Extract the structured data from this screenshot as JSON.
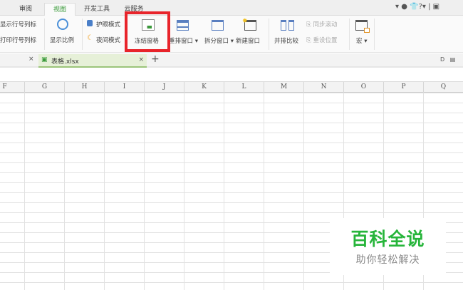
{
  "menu_tabs": [
    "审阅",
    "视图",
    "开发工具",
    "云服务"
  ],
  "active_tab": "视图",
  "ribbon": {
    "show_row_col": "显示行号列标",
    "print_row_col": "打印行号列标",
    "zoom": "显示比例",
    "eye_mode": "护眼模式",
    "night_mode": "夜间模式",
    "freeze": "冻结窗格",
    "arrange": "重排窗口",
    "split": "拆分窗口",
    "new_window": "新建窗口",
    "side_by_side": "并排比较",
    "sync_scroll": "同步滚动",
    "reset_pos": "重设位置",
    "macro": "宏"
  },
  "top_right": [
    "?"
  ],
  "document_tab": {
    "name": "表格.xlsx",
    "close": "×",
    "add": "+",
    "left_close": "×"
  },
  "columns": [
    "F",
    "G",
    "H",
    "I",
    "J",
    "K",
    "L",
    "M",
    "N",
    "O",
    "P",
    "Q"
  ],
  "watermark": {
    "title": "百科全说",
    "subtitle": "助你轻松解决"
  }
}
